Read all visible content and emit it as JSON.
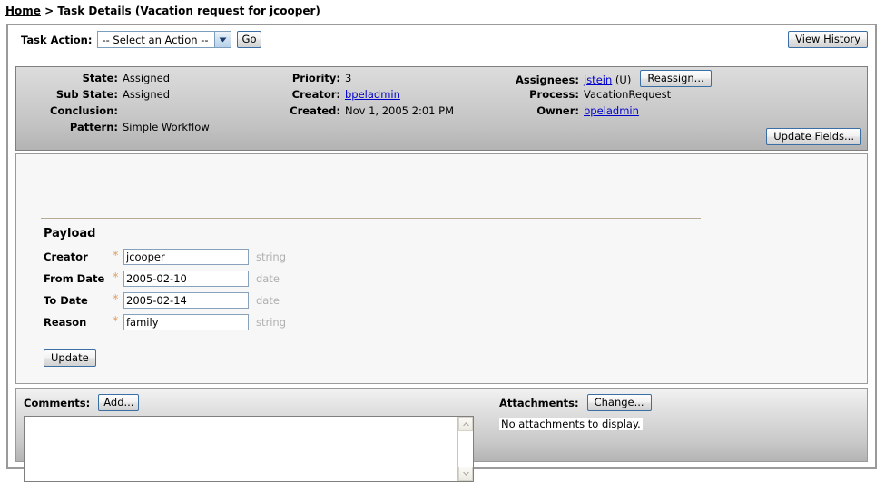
{
  "breadcrumb": {
    "home_label": "Home",
    "separator": ">",
    "current": "Task Details (Vacation request for jcooper)"
  },
  "action_bar": {
    "label": "Task Action:",
    "select_value": "-- Select an Action --",
    "go_label": "Go",
    "view_history_label": "View History"
  },
  "info": {
    "col1": [
      {
        "key": "State:",
        "value": "Assigned"
      },
      {
        "key": "Sub State:",
        "value": "Assigned"
      },
      {
        "key": "Conclusion:",
        "value": ""
      },
      {
        "key": "Pattern:",
        "value": "Simple Workflow"
      }
    ],
    "col2": [
      {
        "key": "Priority:",
        "value": "3"
      },
      {
        "key": "Creator:",
        "value": "bpeladmin"
      },
      {
        "key": "Created:",
        "value": "Nov 1, 2005 2:01 PM"
      }
    ],
    "col3": [
      {
        "key": "Assignees:",
        "value": "jstein",
        "suffix": "(U)"
      },
      {
        "key": "Process:",
        "value": "VacationRequest"
      },
      {
        "key": "Owner:",
        "value": "bpeladmin"
      }
    ],
    "reassign_label": "Reassign...",
    "update_fields_label": "Update Fields..."
  },
  "payload": {
    "title": "Payload",
    "fields": [
      {
        "label": "Creator",
        "required": "*",
        "value": "jcooper",
        "type": "string"
      },
      {
        "label": "From Date",
        "required": "*",
        "value": "2005-02-10",
        "type": "date"
      },
      {
        "label": "To Date",
        "required": "*",
        "value": "2005-02-14",
        "type": "date"
      },
      {
        "label": "Reason",
        "required": "*",
        "value": "family",
        "type": "string"
      }
    ],
    "update_label": "Update"
  },
  "comments": {
    "label": "Comments:",
    "add_label": "Add...",
    "value": ""
  },
  "attachments": {
    "label": "Attachments:",
    "change_label": "Change...",
    "empty_text": "No attachments to display."
  },
  "colors": {
    "link": "#0000cc",
    "button_border": "#3a6ea5",
    "panel_border": "#7f7f7f",
    "rule": "#b5ac95",
    "required_star": "#e0a060",
    "type_hint": "#b0b0b0"
  }
}
